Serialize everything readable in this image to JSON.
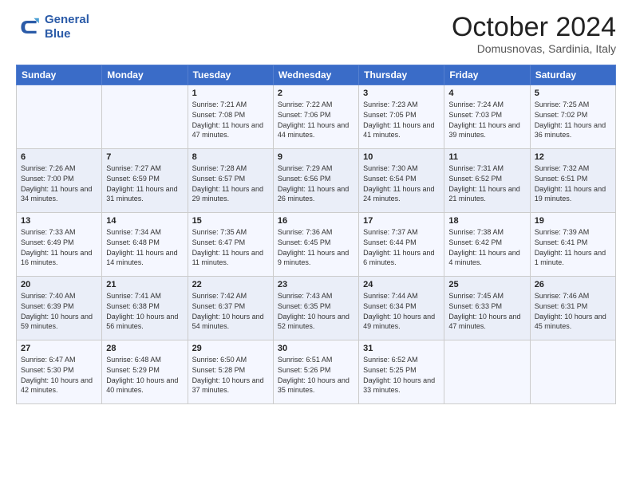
{
  "logo": {
    "line1": "General",
    "line2": "Blue"
  },
  "title": "October 2024",
  "subtitle": "Domusnovas, Sardinia, Italy",
  "headers": [
    "Sunday",
    "Monday",
    "Tuesday",
    "Wednesday",
    "Thursday",
    "Friday",
    "Saturday"
  ],
  "weeks": [
    [
      {
        "day": "",
        "info": ""
      },
      {
        "day": "",
        "info": ""
      },
      {
        "day": "1",
        "info": "Sunrise: 7:21 AM\nSunset: 7:08 PM\nDaylight: 11 hours and 47 minutes."
      },
      {
        "day": "2",
        "info": "Sunrise: 7:22 AM\nSunset: 7:06 PM\nDaylight: 11 hours and 44 minutes."
      },
      {
        "day": "3",
        "info": "Sunrise: 7:23 AM\nSunset: 7:05 PM\nDaylight: 11 hours and 41 minutes."
      },
      {
        "day": "4",
        "info": "Sunrise: 7:24 AM\nSunset: 7:03 PM\nDaylight: 11 hours and 39 minutes."
      },
      {
        "day": "5",
        "info": "Sunrise: 7:25 AM\nSunset: 7:02 PM\nDaylight: 11 hours and 36 minutes."
      }
    ],
    [
      {
        "day": "6",
        "info": "Sunrise: 7:26 AM\nSunset: 7:00 PM\nDaylight: 11 hours and 34 minutes."
      },
      {
        "day": "7",
        "info": "Sunrise: 7:27 AM\nSunset: 6:59 PM\nDaylight: 11 hours and 31 minutes."
      },
      {
        "day": "8",
        "info": "Sunrise: 7:28 AM\nSunset: 6:57 PM\nDaylight: 11 hours and 29 minutes."
      },
      {
        "day": "9",
        "info": "Sunrise: 7:29 AM\nSunset: 6:56 PM\nDaylight: 11 hours and 26 minutes."
      },
      {
        "day": "10",
        "info": "Sunrise: 7:30 AM\nSunset: 6:54 PM\nDaylight: 11 hours and 24 minutes."
      },
      {
        "day": "11",
        "info": "Sunrise: 7:31 AM\nSunset: 6:52 PM\nDaylight: 11 hours and 21 minutes."
      },
      {
        "day": "12",
        "info": "Sunrise: 7:32 AM\nSunset: 6:51 PM\nDaylight: 11 hours and 19 minutes."
      }
    ],
    [
      {
        "day": "13",
        "info": "Sunrise: 7:33 AM\nSunset: 6:49 PM\nDaylight: 11 hours and 16 minutes."
      },
      {
        "day": "14",
        "info": "Sunrise: 7:34 AM\nSunset: 6:48 PM\nDaylight: 11 hours and 14 minutes."
      },
      {
        "day": "15",
        "info": "Sunrise: 7:35 AM\nSunset: 6:47 PM\nDaylight: 11 hours and 11 minutes."
      },
      {
        "day": "16",
        "info": "Sunrise: 7:36 AM\nSunset: 6:45 PM\nDaylight: 11 hours and 9 minutes."
      },
      {
        "day": "17",
        "info": "Sunrise: 7:37 AM\nSunset: 6:44 PM\nDaylight: 11 hours and 6 minutes."
      },
      {
        "day": "18",
        "info": "Sunrise: 7:38 AM\nSunset: 6:42 PM\nDaylight: 11 hours and 4 minutes."
      },
      {
        "day": "19",
        "info": "Sunrise: 7:39 AM\nSunset: 6:41 PM\nDaylight: 11 hours and 1 minute."
      }
    ],
    [
      {
        "day": "20",
        "info": "Sunrise: 7:40 AM\nSunset: 6:39 PM\nDaylight: 10 hours and 59 minutes."
      },
      {
        "day": "21",
        "info": "Sunrise: 7:41 AM\nSunset: 6:38 PM\nDaylight: 10 hours and 56 minutes."
      },
      {
        "day": "22",
        "info": "Sunrise: 7:42 AM\nSunset: 6:37 PM\nDaylight: 10 hours and 54 minutes."
      },
      {
        "day": "23",
        "info": "Sunrise: 7:43 AM\nSunset: 6:35 PM\nDaylight: 10 hours and 52 minutes."
      },
      {
        "day": "24",
        "info": "Sunrise: 7:44 AM\nSunset: 6:34 PM\nDaylight: 10 hours and 49 minutes."
      },
      {
        "day": "25",
        "info": "Sunrise: 7:45 AM\nSunset: 6:33 PM\nDaylight: 10 hours and 47 minutes."
      },
      {
        "day": "26",
        "info": "Sunrise: 7:46 AM\nSunset: 6:31 PM\nDaylight: 10 hours and 45 minutes."
      }
    ],
    [
      {
        "day": "27",
        "info": "Sunrise: 6:47 AM\nSunset: 5:30 PM\nDaylight: 10 hours and 42 minutes."
      },
      {
        "day": "28",
        "info": "Sunrise: 6:48 AM\nSunset: 5:29 PM\nDaylight: 10 hours and 40 minutes."
      },
      {
        "day": "29",
        "info": "Sunrise: 6:50 AM\nSunset: 5:28 PM\nDaylight: 10 hours and 37 minutes."
      },
      {
        "day": "30",
        "info": "Sunrise: 6:51 AM\nSunset: 5:26 PM\nDaylight: 10 hours and 35 minutes."
      },
      {
        "day": "31",
        "info": "Sunrise: 6:52 AM\nSunset: 5:25 PM\nDaylight: 10 hours and 33 minutes."
      },
      {
        "day": "",
        "info": ""
      },
      {
        "day": "",
        "info": ""
      }
    ]
  ]
}
